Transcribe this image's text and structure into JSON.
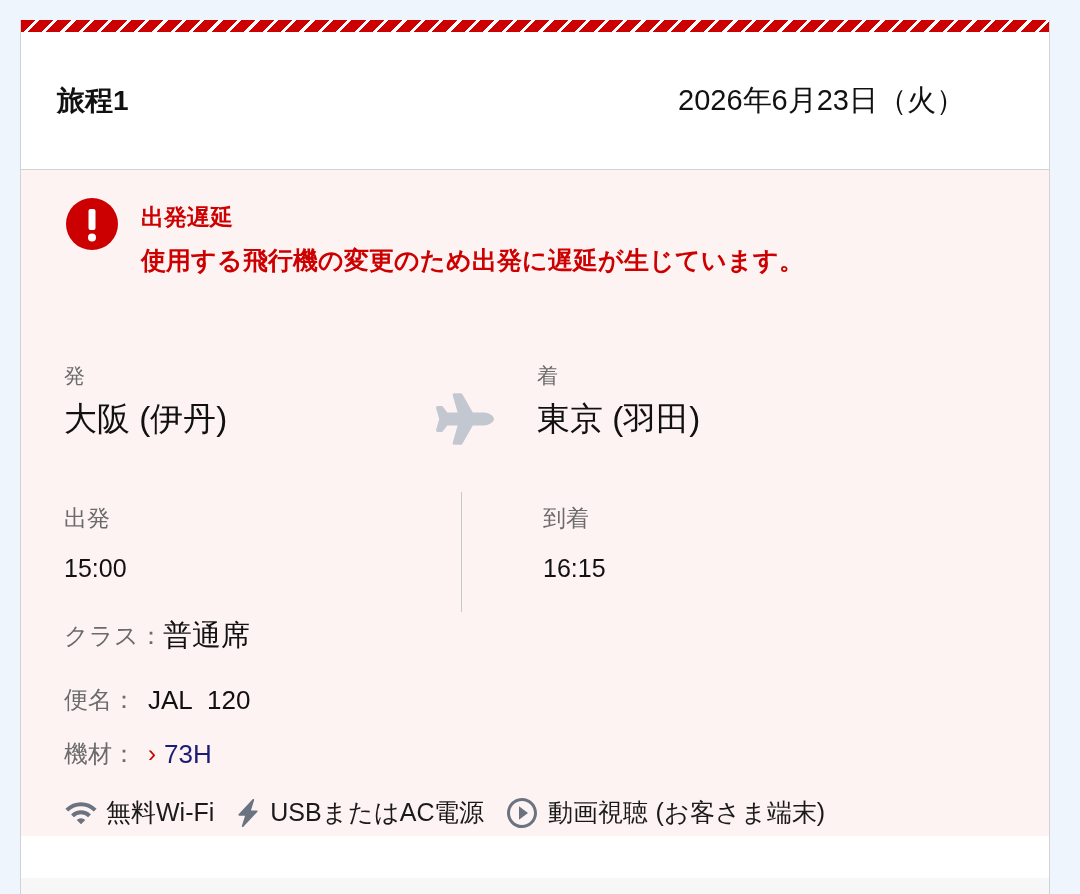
{
  "itinerary": {
    "title": "旅程1",
    "date": "2026年6月23日（火）"
  },
  "alert": {
    "kind": "error",
    "title": "出発遅延",
    "message": "使用する飛行機の変更のため出発に遅延が生じています。"
  },
  "route": {
    "origin": {
      "label": "発",
      "city": "大阪 (伊丹)"
    },
    "destination": {
      "label": "着",
      "city": "東京 (羽田)"
    }
  },
  "times": [
    {
      "label": "出発",
      "value": "15:00"
    },
    {
      "label": "到着",
      "value": "16:15"
    }
  ],
  "details": [
    {
      "kind": "class",
      "label": "クラス：",
      "value": "普通席"
    },
    {
      "kind": "text",
      "label": "便名：",
      "value": "JAL 120"
    },
    {
      "kind": "link",
      "label": "機材：",
      "marker": "›",
      "value": "73H"
    }
  ],
  "amenities": [
    {
      "kind": "wifi",
      "label": "無料Wi-Fi"
    },
    {
      "kind": "power",
      "label": "USBまたはAC電源"
    },
    {
      "kind": "video",
      "label": "動画視聴 (お客さま端末)"
    }
  ]
}
